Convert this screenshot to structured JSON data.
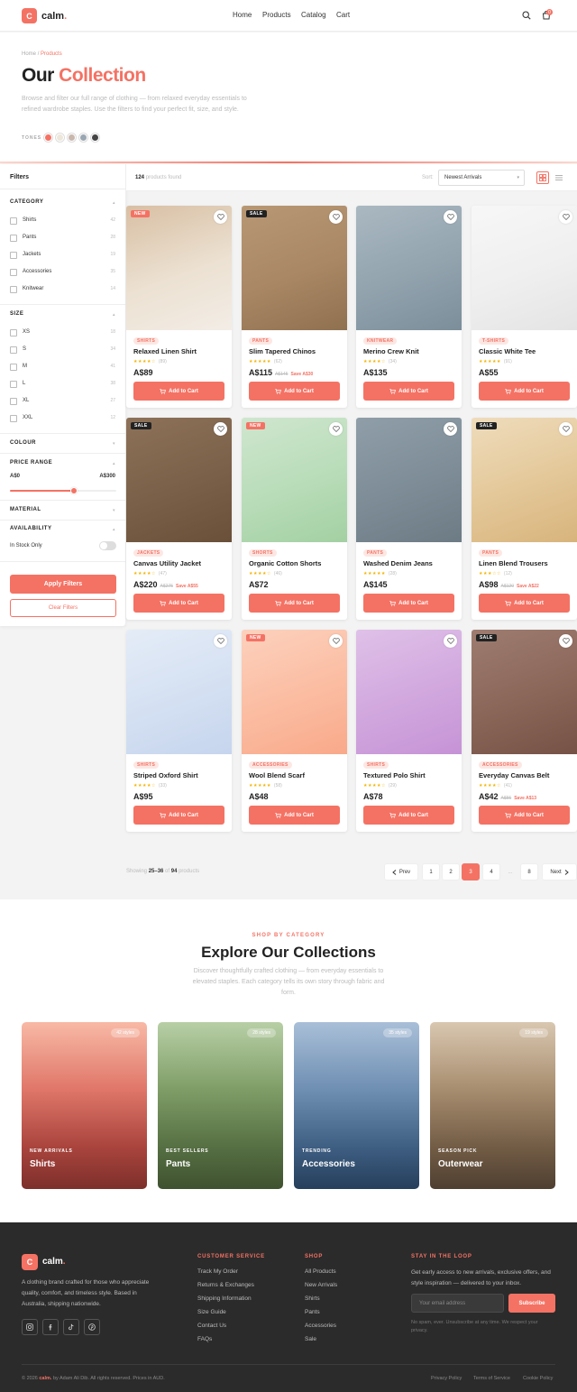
{
  "header": {
    "logo_letter": "C",
    "brand": "calm",
    "brand_dot": ".",
    "nav": [
      "Home",
      "Products",
      "Catalog",
      "Cart"
    ],
    "cart_count": "0"
  },
  "hero": {
    "breadcrumb_home": "Home",
    "breadcrumb_sep": "/",
    "breadcrumb_current": "Products",
    "title_plain": "Our ",
    "title_accent": "Collection",
    "description": "Browse and filter our full range of clothing — from relaxed everyday essentials to refined wardrobe staples. Use the filters to find your perfect fit, size, and style.",
    "tones_label": "TONES",
    "tones": [
      "#f47264",
      "#ede6da",
      "#c9b7ae",
      "#9aa7b3",
      "#444444"
    ]
  },
  "filters": {
    "title": "Filters",
    "category_title": "CATEGORY",
    "categories": [
      {
        "label": "Shirts",
        "count": "42"
      },
      {
        "label": "Pants",
        "count": "28"
      },
      {
        "label": "Jackets",
        "count": "19"
      },
      {
        "label": "Accessories",
        "count": "35"
      },
      {
        "label": "Knitwear",
        "count": "14"
      }
    ],
    "size_title": "SIZE",
    "sizes": [
      {
        "label": "XS",
        "count": "18"
      },
      {
        "label": "S",
        "count": "34"
      },
      {
        "label": "M",
        "count": "41"
      },
      {
        "label": "L",
        "count": "38"
      },
      {
        "label": "XL",
        "count": "27"
      },
      {
        "label": "XXL",
        "count": "12"
      }
    ],
    "colour_title": "COLOUR",
    "price_title": "PRICE RANGE",
    "price_min": "A$0",
    "price_max": "A$300",
    "price_slider_fraction": 0.6,
    "material_title": "MATERIAL",
    "availability_title": "AVAILABILITY",
    "in_stock_label": "In Stock Only",
    "in_stock_on": false,
    "apply_label": "Apply Filters",
    "clear_label": "Clear Filters"
  },
  "toolbar": {
    "count": "124",
    "count_suffix": "products found",
    "sort_label": "Sort:",
    "sort_value": "Newest Arrivals"
  },
  "products": [
    {
      "name": "Relaxed Linen Shirt",
      "category": "SHIRTS",
      "badge": "NEW",
      "rating": 4,
      "reviews": "(89)",
      "price": "A$89",
      "old_price": "",
      "save": "",
      "img": [
        "#d8bfa3",
        "#ece1d2",
        "#f3ede6"
      ]
    },
    {
      "name": "Slim Tapered Chinos",
      "category": "PANTS",
      "badge": "SALE",
      "rating": 5,
      "reviews": "(62)",
      "price": "A$115",
      "old_price": "A$145",
      "save": "Save A$30",
      "img": [
        "#b89874",
        "#a98765",
        "#8f704f"
      ]
    },
    {
      "name": "Merino Crew Knit",
      "category": "KNITWEAR",
      "badge": "",
      "rating": 4,
      "reviews": "(34)",
      "price": "A$135",
      "old_price": "",
      "save": "",
      "img": [
        "#aab8c1",
        "#92a3ae",
        "#7b8e9a"
      ]
    },
    {
      "name": "Classic White Tee",
      "category": "T-SHIRTS",
      "badge": "",
      "rating": 5,
      "reviews": "(91)",
      "price": "A$55",
      "old_price": "",
      "save": "",
      "img": [
        "#f7f7f7",
        "#efefef",
        "#e4e4e4"
      ]
    },
    {
      "name": "Canvas Utility Jacket",
      "category": "JACKETS",
      "badge": "SALE",
      "rating": 4,
      "reviews": "(47)",
      "price": "A$220",
      "old_price": "A$275",
      "save": "Save A$55",
      "img": [
        "#8d7259",
        "#7a6048",
        "#6a5039"
      ]
    },
    {
      "name": "Organic Cotton Shorts",
      "category": "SHORTS",
      "badge": "NEW",
      "rating": 4,
      "reviews": "(46)",
      "price": "A$72",
      "old_price": "",
      "save": "",
      "img": [
        "#cfe6cf",
        "#b8dcb8",
        "#a3d0a3"
      ]
    },
    {
      "name": "Washed Denim Jeans",
      "category": "PANTS",
      "badge": "",
      "rating": 5,
      "reviews": "(28)",
      "price": "A$145",
      "old_price": "",
      "save": "",
      "img": [
        "#8f9ea8",
        "#7d8c96",
        "#6d7b85"
      ]
    },
    {
      "name": "Linen Blend Trousers",
      "category": "PANTS",
      "badge": "SALE",
      "rating": 3,
      "reviews": "(12)",
      "price": "A$98",
      "old_price": "A$120",
      "save": "Save A$22",
      "img": [
        "#efdcbc",
        "#e3c798",
        "#d8b47c"
      ]
    },
    {
      "name": "Striped Oxford Shirt",
      "category": "SHIRTS",
      "badge": "",
      "rating": 4,
      "reviews": "(33)",
      "price": "A$95",
      "old_price": "",
      "save": "",
      "img": [
        "#e4ecf7",
        "#d4e0f2",
        "#c6d5ee"
      ]
    },
    {
      "name": "Wool Blend Scarf",
      "category": "ACCESSORIES",
      "badge": "NEW",
      "rating": 5,
      "reviews": "(58)",
      "price": "A$48",
      "old_price": "",
      "save": "",
      "img": [
        "#fcd1bd",
        "#fbbca1",
        "#f9a98a"
      ]
    },
    {
      "name": "Textured Polo Shirt",
      "category": "SHIRTS",
      "badge": "",
      "rating": 4,
      "reviews": "(29)",
      "price": "A$78",
      "old_price": "",
      "save": "",
      "img": [
        "#dfc1e8",
        "#d1a7de",
        "#c693d6"
      ]
    },
    {
      "name": "Everyday Canvas Belt",
      "category": "ACCESSORIES",
      "badge": "SALE",
      "rating": 4,
      "reviews": "(41)",
      "price": "A$42",
      "old_price": "A$55",
      "save": "Save A$13",
      "img": [
        "#9e7c70",
        "#8a6659",
        "#765246"
      ]
    }
  ],
  "add_to_cart_label": "Add to Cart",
  "pagination": {
    "showing_prefix": "Showing",
    "range": "25–36",
    "of_word": "of",
    "total": "94",
    "suffix": "products",
    "prev_label": "Prev",
    "next_label": "Next",
    "pages": [
      "1",
      "2",
      "3",
      "4",
      "...",
      "8"
    ],
    "current": "3"
  },
  "collections": {
    "kicker": "SHOP BY CATEGORY",
    "title": "Explore Our Collections",
    "description": "Discover thoughtfully crafted clothing — from everyday essentials to elevated staples. Each category tells its own story through fabric and form.",
    "items": [
      {
        "kicker": "NEW ARRIVALS",
        "name": "Shirts",
        "styles": "42 styles",
        "colors": [
          "#f8b9a5",
          "#e0776a",
          "#a9443d",
          "#7d2f2b"
        ]
      },
      {
        "kicker": "BEST SELLERS",
        "name": "Pants",
        "styles": "28 styles",
        "colors": [
          "#b8cfa6",
          "#7f9e67",
          "#566f43",
          "#3f5230"
        ]
      },
      {
        "kicker": "TRENDING",
        "name": "Accessories",
        "styles": "35 styles",
        "colors": [
          "#a9bfd8",
          "#6f8fb3",
          "#3e5e82",
          "#263f5c"
        ]
      },
      {
        "kicker": "SEASON PICK",
        "name": "Outerwear",
        "styles": "19 styles",
        "colors": [
          "#d9c7b0",
          "#a88e70",
          "#725c45",
          "#4f3f31"
        ]
      }
    ]
  },
  "footer": {
    "logo_letter": "C",
    "brand": "calm",
    "brand_dot": ".",
    "tagline": "A clothing brand crafted for those who appreciate quality, comfort, and timeless style. Based in Australia, shipping nationwide.",
    "social_icons": [
      "instagram-icon",
      "facebook-icon",
      "tiktok-icon",
      "pinterest-icon"
    ],
    "service_title": "CUSTOMER SERVICE",
    "service_links": [
      "Track My Order",
      "Returns & Exchanges",
      "Shipping Information",
      "Size Guide",
      "Contact Us",
      "FAQs"
    ],
    "shop_title": "SHOP",
    "shop_links": [
      "All Products",
      "New Arrivals",
      "Shirts",
      "Pants",
      "Accessories",
      "Sale"
    ],
    "news_title": "STAY IN THE LOOP",
    "news_desc": "Get early access to new arrivals, exclusive offers, and style inspiration — delivered to your inbox.",
    "email_placeholder": "Your email address",
    "subscribe_label": "Subscribe",
    "spam_note": "No spam, ever. Unsubscribe at any time. We respect your privacy.",
    "copy_prefix": "© 2026",
    "copy_brand": "calm.",
    "copy_suffix": "by Adam Ali Dib. All rights reserved. Prices in AUD.",
    "legal_links": [
      "Privacy Policy",
      "Terms of Service",
      "Cookie Policy"
    ]
  },
  "colors": {
    "accent": "#f47264",
    "dark": "#222222",
    "footer_bg": "#2b2b2b"
  }
}
